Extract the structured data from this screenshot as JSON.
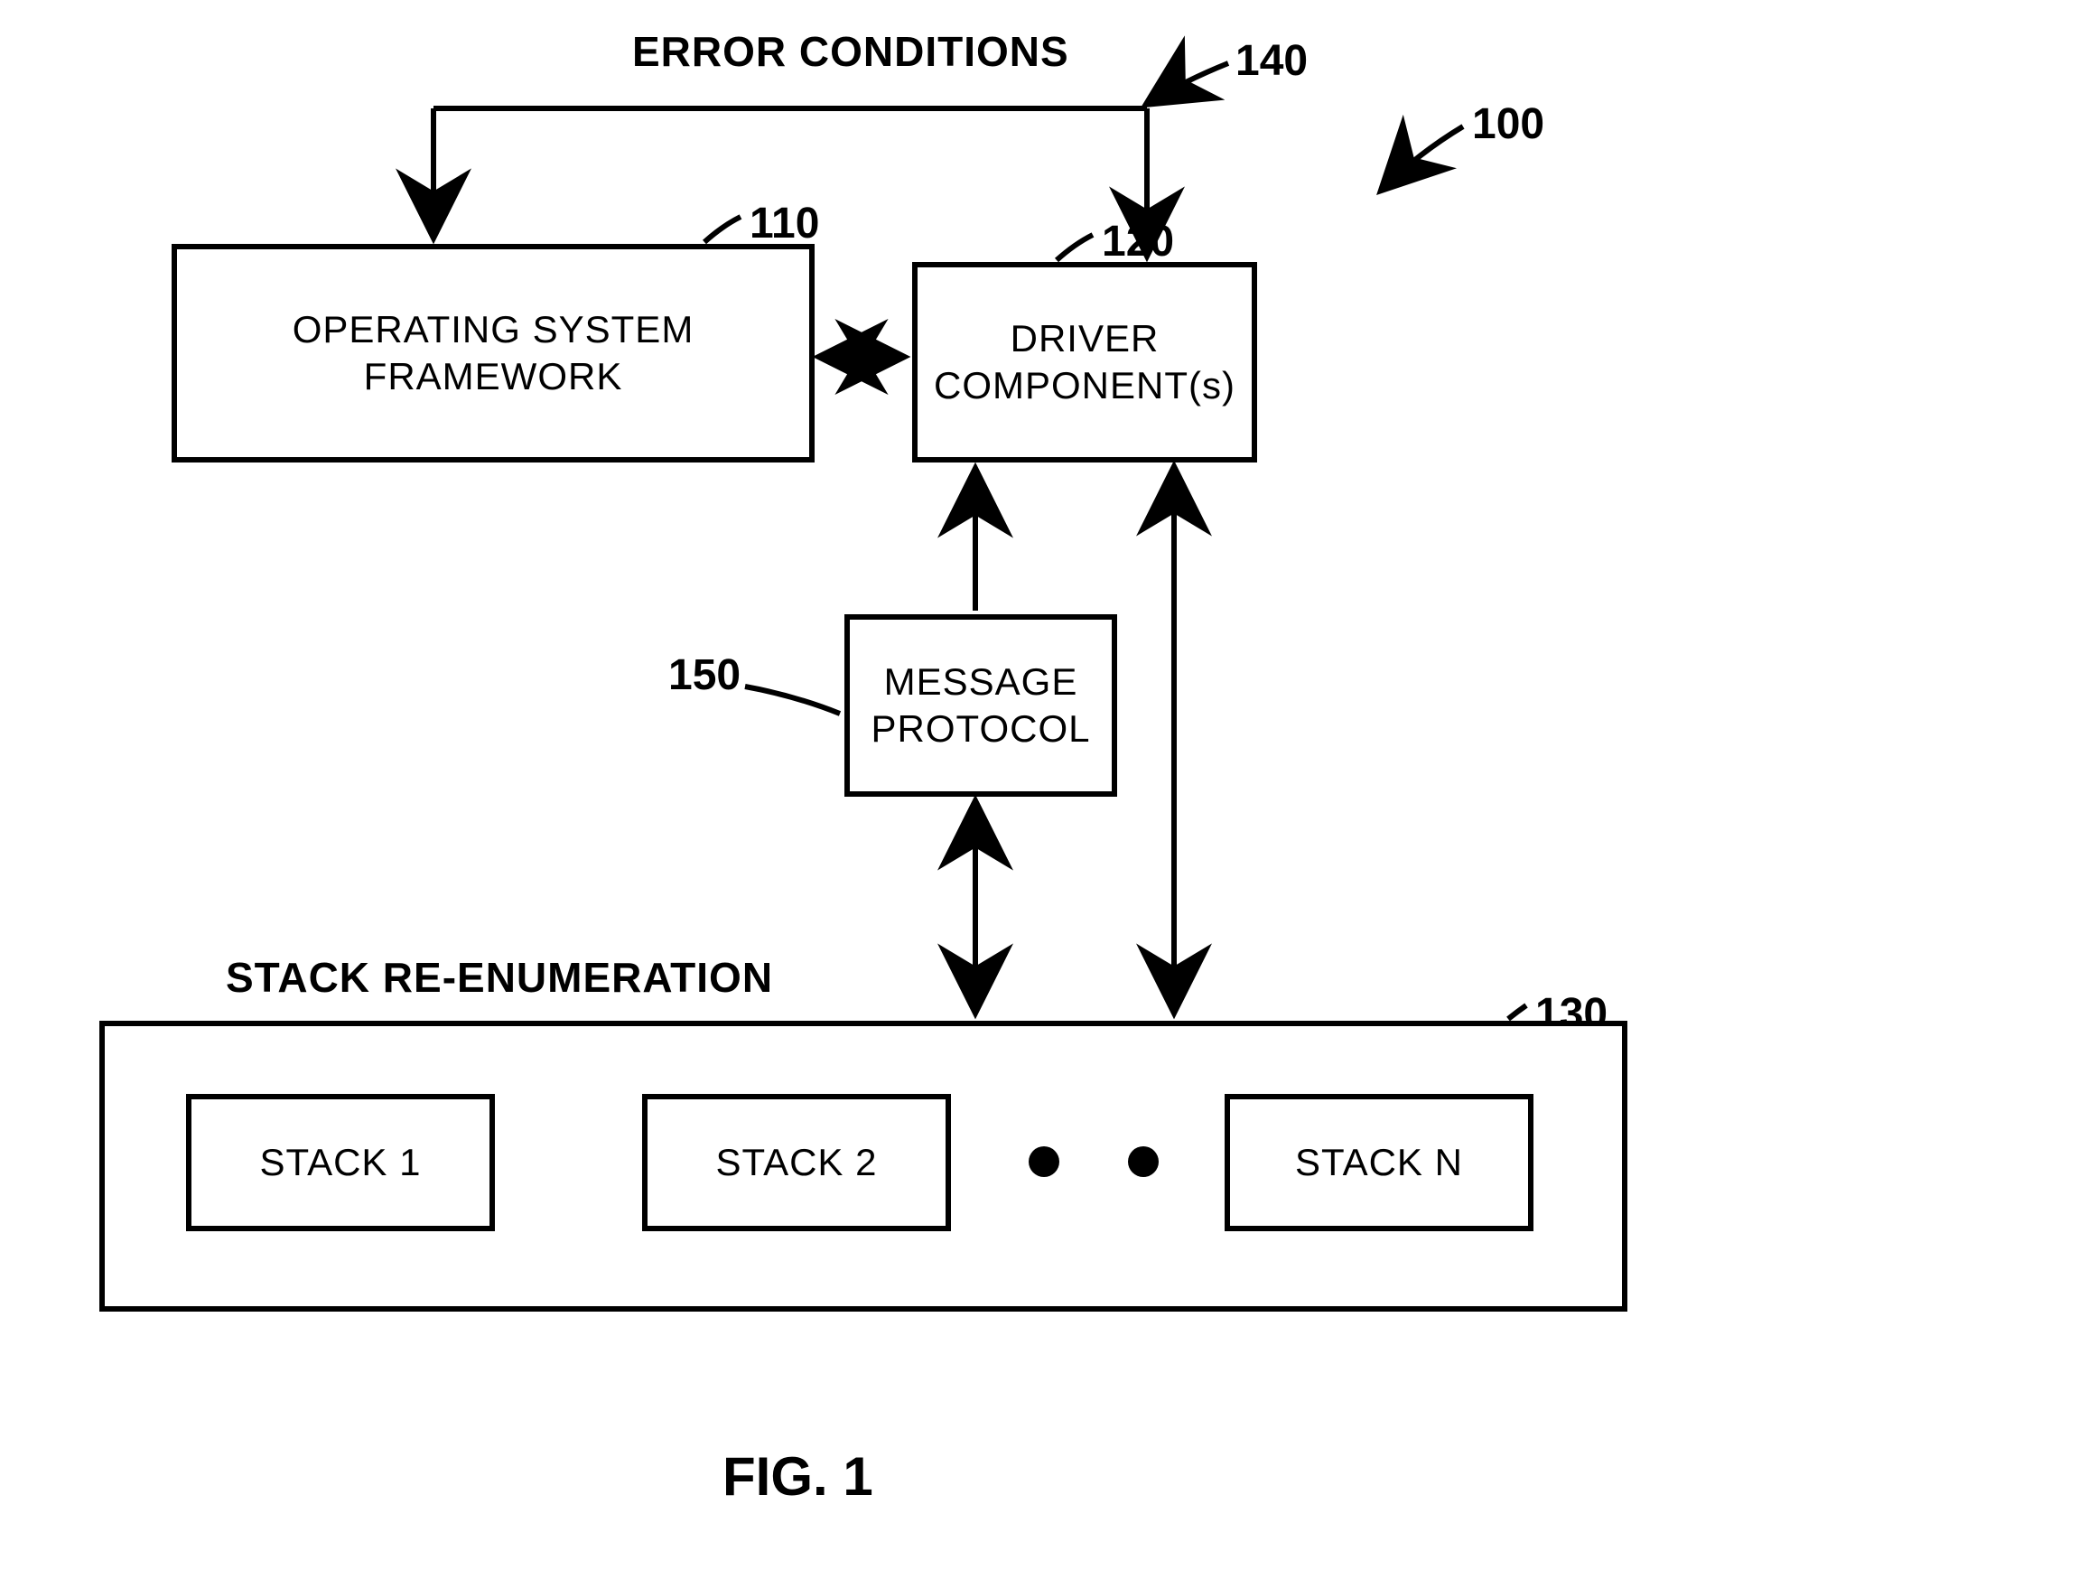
{
  "title_error": "ERROR CONDITIONS",
  "title_stack": "STACK RE-ENUMERATION",
  "ref_100": "100",
  "ref_110": "110",
  "ref_120": "120",
  "ref_130": "130",
  "ref_140": "140",
  "ref_150": "150",
  "box_os": "OPERATING SYSTEM FRAMEWORK",
  "box_driver": "DRIVER COMPONENT(s)",
  "box_msg": "MESSAGE PROTOCOL",
  "stack1": "STACK 1",
  "stack2": "STACK 2",
  "stackN": "STACK N",
  "chart_data": {
    "type": "diagram",
    "nodes": [
      {
        "id": "os",
        "label": "OPERATING SYSTEM FRAMEWORK",
        "ref": 110
      },
      {
        "id": "driver",
        "label": "DRIVER COMPONENT(s)",
        "ref": 120
      },
      {
        "id": "msg",
        "label": "MESSAGE PROTOCOL",
        "ref": 150
      },
      {
        "id": "stacks",
        "label": "STACK RE-ENUMERATION",
        "ref": 130,
        "children": [
          "STACK 1",
          "STACK 2",
          "...",
          "STACK N"
        ]
      },
      {
        "id": "error",
        "label": "ERROR CONDITIONS",
        "ref": 140
      },
      {
        "id": "system",
        "label": "",
        "ref": 100
      }
    ],
    "edges": [
      {
        "from": "os",
        "to": "driver",
        "dir": "both"
      },
      {
        "from": "driver",
        "to": "msg",
        "dir": "one"
      },
      {
        "from": "msg",
        "to": "stacks",
        "dir": "both"
      },
      {
        "from": "driver",
        "to": "stacks",
        "dir": "both"
      },
      {
        "from": "error",
        "to": "os",
        "dir": "one"
      },
      {
        "from": "error",
        "to": "driver",
        "dir": "one"
      }
    ]
  }
}
